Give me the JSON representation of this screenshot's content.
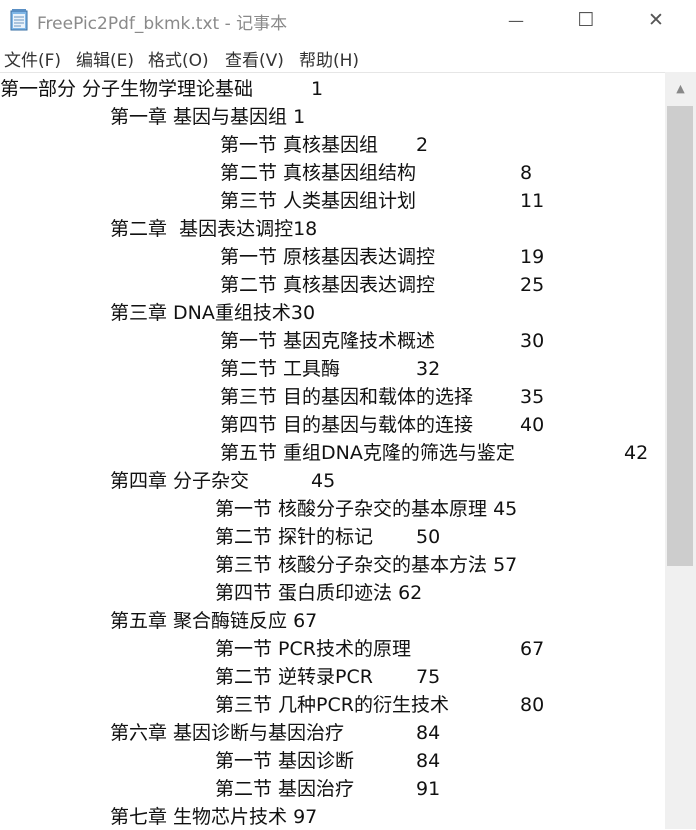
{
  "window": {
    "title": "FreePic2Pdf_bkmk.txt - 记事本"
  },
  "menu": [
    "文件(F)",
    "编辑(E)",
    "格式(O)",
    "查看(V)",
    "帮助(H)"
  ],
  "lines": [
    {
      "text": "第一部分 分子生物学理论基础",
      "page": "1"
    },
    {
      "text": "第一章 基因与基因组 1",
      "page": ""
    },
    {
      "text": "第一节 真核基因组",
      "page": "2"
    },
    {
      "text": "第二节 真核基因组结构",
      "page": "8"
    },
    {
      "text": "第三节 人类基因组计划",
      "page": "11"
    },
    {
      "text": "第二章  基因表达调控18",
      "page": ""
    },
    {
      "text": "第一节 原核基因表达调控",
      "page": "19"
    },
    {
      "text": "第二节 真核基因表达调控",
      "page": "25"
    },
    {
      "text": "第三章 DNA重组技术30",
      "page": ""
    },
    {
      "text": "第一节 基因克隆技术概述",
      "page": "30"
    },
    {
      "text": "第二节 工具酶",
      "page": "32"
    },
    {
      "text": "第三节 目的基因和载体的选择",
      "page": "35"
    },
    {
      "text": "第四节 目的基因与载体的连接",
      "page": "40"
    },
    {
      "text": "第五节 重组DNA克隆的筛选与鉴定",
      "page": "42"
    },
    {
      "text": "第四章 分子杂交",
      "page": "45"
    },
    {
      "text": "第一节 核酸分子杂交的基本原理 45",
      "page": ""
    },
    {
      "text": "第二节 探针的标记",
      "page": "50"
    },
    {
      "text": "第三节 核酸分子杂交的基本方法 57",
      "page": ""
    },
    {
      "text": "第四节 蛋白质印迹法 62",
      "page": ""
    },
    {
      "text": "第五章 聚合酶链反应 67",
      "page": ""
    },
    {
      "text": "第一节 PCR技术的原理",
      "page": "67"
    },
    {
      "text": "第二节 逆转录PCR",
      "page": "75"
    },
    {
      "text": "第三节 几种PCR的衍生技术",
      "page": "80"
    },
    {
      "text": "第六章 基因诊断与基因治疗",
      "page": "84"
    },
    {
      "text": "第一节 基因诊断",
      "page": "84"
    },
    {
      "text": "第二节 基因治疗",
      "page": "91"
    },
    {
      "text": "第七章 生物芯片技术 97",
      "page": ""
    }
  ],
  "controls": {
    "minimize": "—",
    "maximize": "☐",
    "close": "✕",
    "scroll_up": "▲"
  }
}
